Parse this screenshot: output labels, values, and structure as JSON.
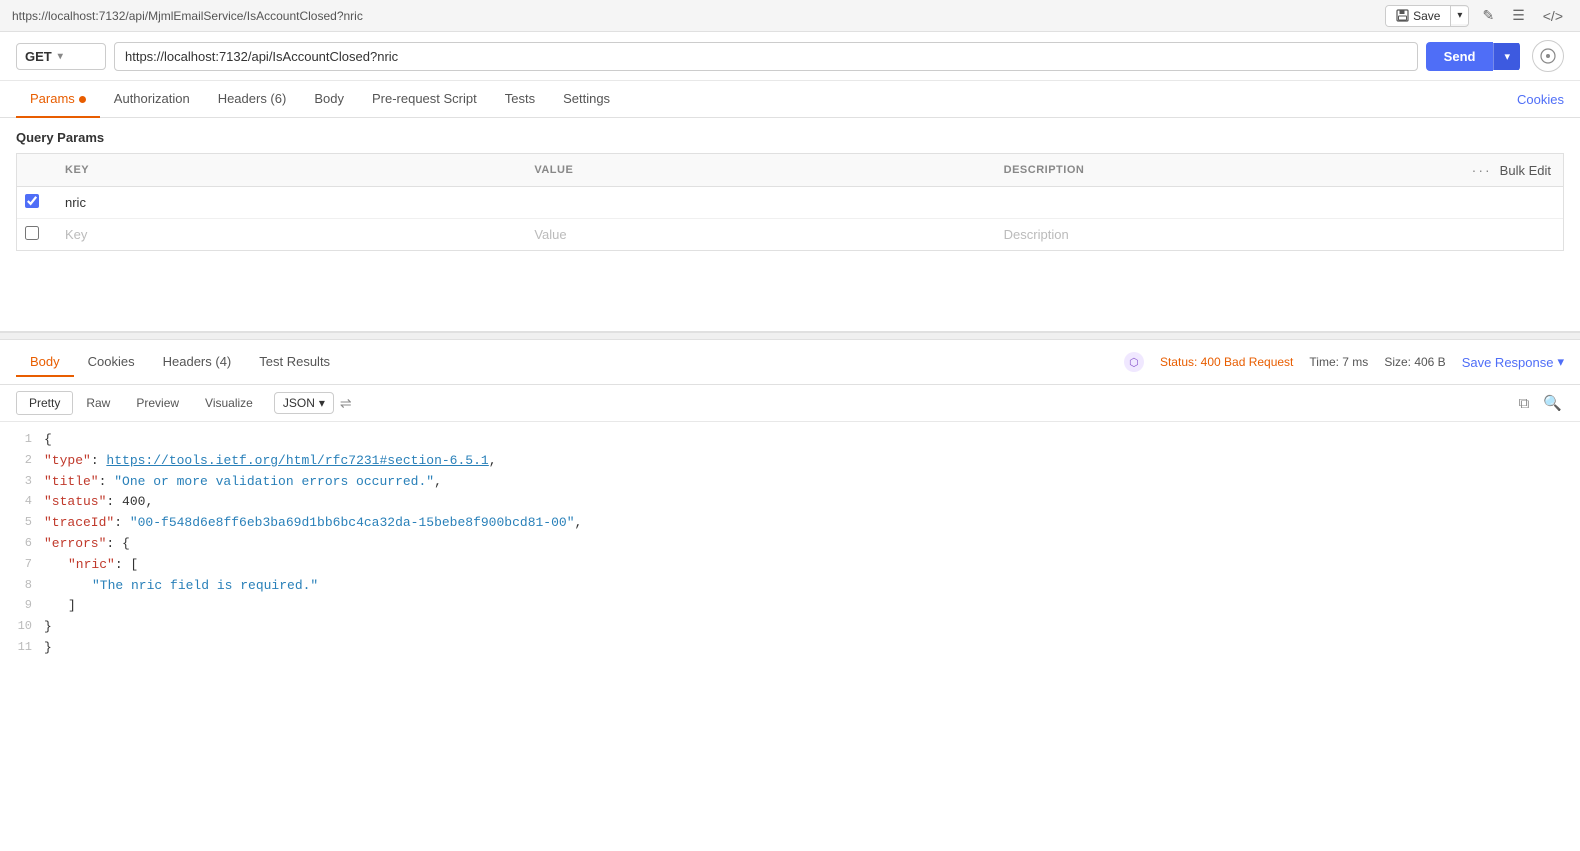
{
  "topbar": {
    "url": "https://localhost:7132/api/MjmlEmailService/IsAccountClosed?nric",
    "save_label": "Save",
    "edit_icon": "✎",
    "doc_icon": "☰",
    "code_icon": "</>",
    "save_arrow": "▾"
  },
  "request": {
    "method": "GET",
    "url_value": "https://localhost:7132/api/IsAccountClosed?nric",
    "send_label": "Send",
    "send_arrow": "▾",
    "eye_icon": "👁"
  },
  "tabs": {
    "items": [
      {
        "label": "Params",
        "active": true,
        "has_dot": true
      },
      {
        "label": "Authorization",
        "active": false,
        "has_dot": false
      },
      {
        "label": "Headers (6)",
        "active": false,
        "has_dot": false
      },
      {
        "label": "Body",
        "active": false,
        "has_dot": false
      },
      {
        "label": "Pre-request Script",
        "active": false,
        "has_dot": false
      },
      {
        "label": "Tests",
        "active": false,
        "has_dot": false
      },
      {
        "label": "Settings",
        "active": false,
        "has_dot": false
      }
    ],
    "cookies_label": "Cookies"
  },
  "query_params": {
    "section_label": "Query Params",
    "columns": {
      "key": "KEY",
      "value": "VALUE",
      "description": "DESCRIPTION"
    },
    "bulk_edit_label": "Bulk Edit",
    "rows": [
      {
        "checked": true,
        "key": "nric",
        "value": "",
        "description": ""
      }
    ],
    "placeholder_row": {
      "key": "Key",
      "value": "Value",
      "description": "Description"
    }
  },
  "response": {
    "tabs": [
      {
        "label": "Body",
        "active": true
      },
      {
        "label": "Cookies",
        "active": false
      },
      {
        "label": "Headers (4)",
        "active": false
      },
      {
        "label": "Test Results",
        "active": false
      }
    ],
    "status": "Status: 400 Bad Request",
    "time": "Time: 7 ms",
    "size": "Size: 406 B",
    "save_response_label": "Save Response",
    "save_arrow": "▾",
    "format_tabs": [
      {
        "label": "Pretty",
        "active": true
      },
      {
        "label": "Raw",
        "active": false
      },
      {
        "label": "Preview",
        "active": false
      },
      {
        "label": "Visualize",
        "active": false
      }
    ],
    "json_format_label": "JSON",
    "code_lines": [
      {
        "num": 1,
        "content": "{",
        "type": "brace"
      },
      {
        "num": 2,
        "content": "    \"type\": \"https://tools.ietf.org/html/rfc7231#section-6.5.1\",",
        "type": "mixed",
        "key": "\"type\"",
        "link": "https://tools.ietf.org/html/rfc7231#section-6.5.1"
      },
      {
        "num": 3,
        "content": "    \"title\": \"One or more validation errors occurred.\",",
        "type": "mixed",
        "key": "\"title\"",
        "val": "\"One or more validation errors occurred.\""
      },
      {
        "num": 4,
        "content": "    \"status\": 400,",
        "type": "mixed",
        "key": "\"status\"",
        "val": "400"
      },
      {
        "num": 5,
        "content": "    \"traceId\": \"00-f548d6e8ff6eb3ba69d1bb6bc4ca32da-15bebe8f900bcd81-00\",",
        "type": "mixed",
        "key": "\"traceId\"",
        "val": "\"00-f548d6e8ff6eb3ba69d1bb6bc4ca32da-15bebe8f900bcd81-00\""
      },
      {
        "num": 6,
        "content": "    \"errors\": {",
        "type": "mixed",
        "key": "\"errors\""
      },
      {
        "num": 7,
        "content": "        \"nric\": [",
        "type": "mixed",
        "key": "\"nric\""
      },
      {
        "num": 8,
        "content": "            \"The nric field is required.\"",
        "type": "string_val",
        "val": "\"The nric field is required.\""
      },
      {
        "num": 9,
        "content": "        ]",
        "type": "brace"
      },
      {
        "num": 10,
        "content": "    }",
        "type": "brace"
      },
      {
        "num": 11,
        "content": "}",
        "type": "brace"
      }
    ]
  },
  "sidebar": {
    "dots": [
      "•",
      "•",
      "•",
      "•",
      "•"
    ]
  }
}
